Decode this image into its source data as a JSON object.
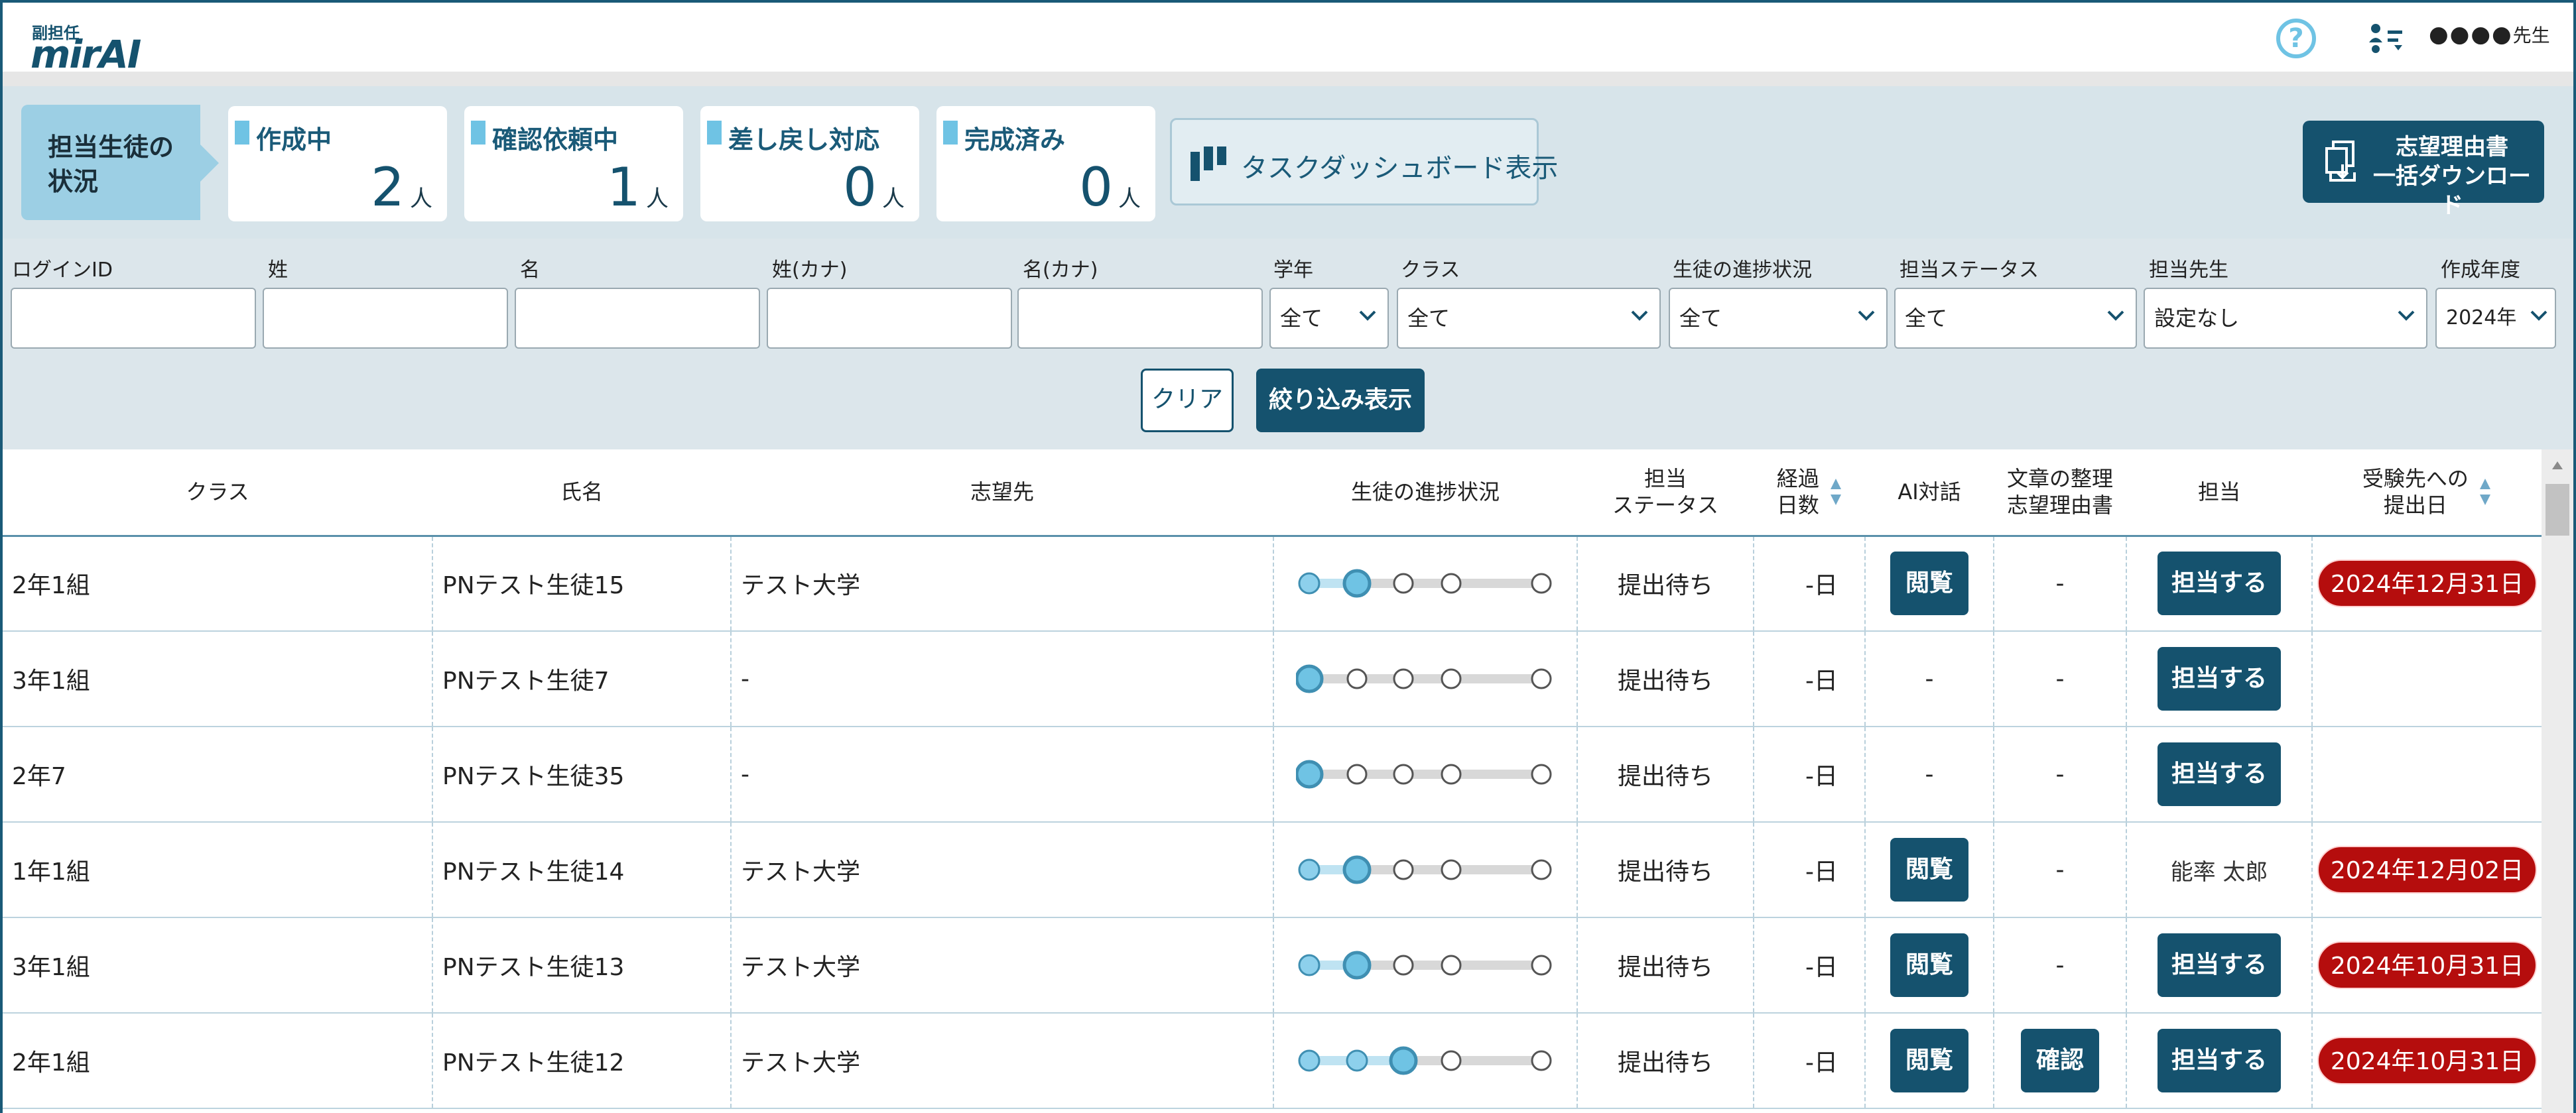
{
  "header": {
    "logo_small": "副担任",
    "logo_main": "mirAI",
    "help_icon": "help-circle-icon",
    "menu_icon": "user-list-icon",
    "user_dots": "●●●●",
    "user_suffix": "先生"
  },
  "summary": {
    "label_line1": "担当生徒の",
    "label_line2": "状況",
    "cards": [
      {
        "label": "作成中",
        "count": "2",
        "unit": "人"
      },
      {
        "label": "確認依頼中",
        "count": "1",
        "unit": "人"
      },
      {
        "label": "差し戻し対応",
        "count": "0",
        "unit": "人"
      },
      {
        "label": "完成済み",
        "count": "0",
        "unit": "人"
      }
    ],
    "dashboard_button": "タスクダッシュボード表示",
    "download_line1": "志望理由書",
    "download_line2": "一括ダウンロード"
  },
  "filters": {
    "login_id": {
      "label": "ログインID",
      "value": ""
    },
    "last_name": {
      "label": "姓",
      "value": ""
    },
    "first_name": {
      "label": "名",
      "value": ""
    },
    "last_name_kana": {
      "label": "姓(カナ)",
      "value": ""
    },
    "first_name_kana": {
      "label": "名(カナ)",
      "value": ""
    },
    "grade": {
      "label": "学年",
      "value": "全て"
    },
    "class": {
      "label": "クラス",
      "value": "全て"
    },
    "progress": {
      "label": "生徒の進捗状況",
      "value": "全て"
    },
    "assign_status": {
      "label": "担当ステータス",
      "value": "全て"
    },
    "teacher": {
      "label": "担当先生",
      "value": "設定なし"
    },
    "year": {
      "label": "作成年度",
      "value": "2024年"
    },
    "clear_button": "クリア",
    "apply_button": "絞り込み表示"
  },
  "table": {
    "headers": {
      "class": "クラス",
      "name": "氏名",
      "destination": "志望先",
      "progress": "生徒の進捗状況",
      "status_line1": "担当",
      "status_line2": "ステータス",
      "days_line1": "経過",
      "days_line2": "日数",
      "ai": "AI対話",
      "doc_line1": "文章の整理",
      "doc_line2": "志望理由書",
      "assignee": "担当",
      "submit_line1": "受験先への",
      "submit_line2": "提出日"
    },
    "rows": [
      {
        "class": "2年1組",
        "name": "PNテスト生徒15",
        "destination": "テスト大学",
        "progress_step": 2,
        "status": "提出待ち",
        "days": "-日",
        "ai": "閲覧",
        "doc": "-",
        "assignee": "担当する",
        "submit": "2024年12月31日"
      },
      {
        "class": "3年1組",
        "name": "PNテスト生徒7",
        "destination": "-",
        "progress_step": 1,
        "status": "提出待ち",
        "days": "-日",
        "ai": "-",
        "doc": "-",
        "assignee": "担当する",
        "submit": ""
      },
      {
        "class": "2年7",
        "name": "PNテスト生徒35",
        "destination": "-",
        "progress_step": 1,
        "status": "提出待ち",
        "days": "-日",
        "ai": "-",
        "doc": "-",
        "assignee": "担当する",
        "submit": ""
      },
      {
        "class": "1年1組",
        "name": "PNテスト生徒14",
        "destination": "テスト大学",
        "progress_step": 2,
        "status": "提出待ち",
        "days": "-日",
        "ai": "閲覧",
        "doc": "-",
        "assignee": "能率 太郎",
        "assignee_is_text": true,
        "submit": "2024年12月02日"
      },
      {
        "class": "3年1組",
        "name": "PNテスト生徒13",
        "destination": "テスト大学",
        "progress_step": 2,
        "status": "提出待ち",
        "days": "-日",
        "ai": "閲覧",
        "doc": "-",
        "assignee": "担当する",
        "submit": "2024年10月31日"
      },
      {
        "class": "2年1組",
        "name": "PNテスト生徒12",
        "destination": "テスト大学",
        "progress_step": 3,
        "status": "提出待ち",
        "days": "-日",
        "ai": "閲覧",
        "doc": "確認",
        "assignee": "担当する",
        "submit": "2024年10月31日"
      }
    ]
  },
  "colors": {
    "primary": "#15526e",
    "accent": "#6fc3e4",
    "danger": "#b50d0d",
    "panel": "#d7e4ea"
  }
}
